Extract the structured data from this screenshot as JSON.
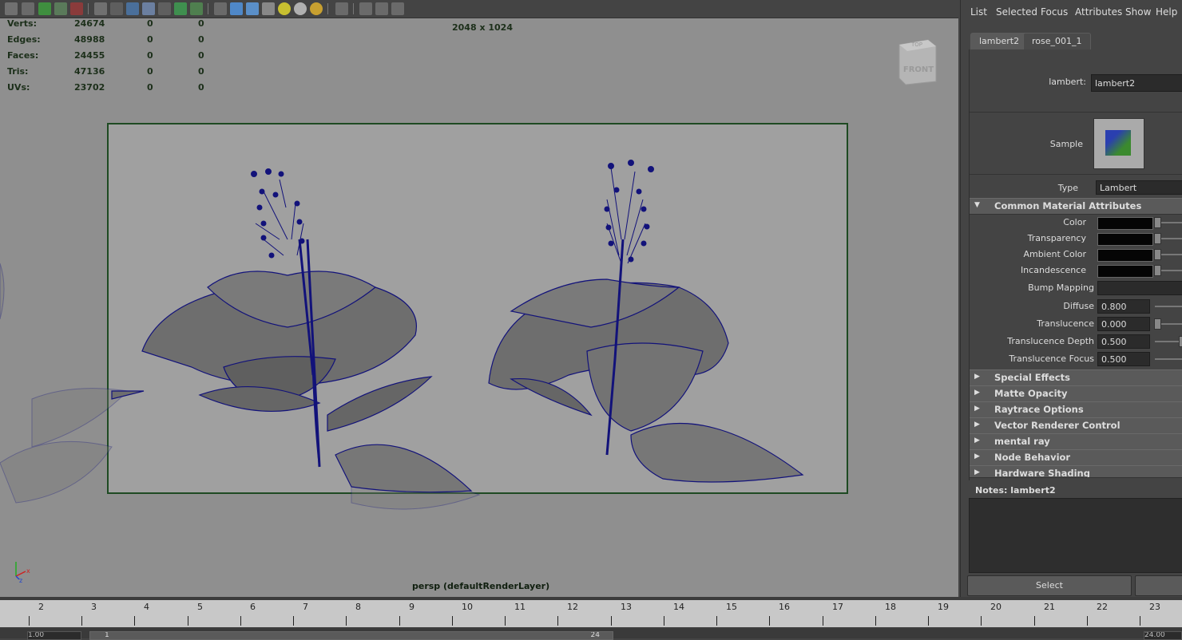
{
  "hud": {
    "rows": [
      {
        "label": "Verts:",
        "value": "24674",
        "c1": "0",
        "c2": "0"
      },
      {
        "label": "Edges:",
        "value": "48988",
        "c1": "0",
        "c2": "0"
      },
      {
        "label": "Faces:",
        "value": "24455",
        "c1": "0",
        "c2": "0"
      },
      {
        "label": "Tris:",
        "value": "47136",
        "c1": "0",
        "c2": "0"
      },
      {
        "label": "UVs:",
        "value": "23702",
        "c1": "0",
        "c2": "0"
      }
    ],
    "resolution": "2048 x 1024",
    "camera": "persp (defaultRenderLayer)"
  },
  "viewcube": {
    "top": "TOP",
    "front": "FRONT"
  },
  "toolbar_icons": [
    "camera-icon",
    "attributes-icon",
    "bookmark-icon",
    "image-plane-icon",
    "grid-icon",
    "film-gate-icon",
    "resolution-gate-icon",
    "safe-area-icon",
    "wireframe-icon",
    "smooth-shade-icon",
    "wireframe-on-shaded-icon",
    "xray-icon",
    "default-material-icon",
    "textured-icon",
    "lights-icon",
    "shadows-icon",
    "select-camera-icon",
    "isolate-icon",
    "frame-all-icon",
    "frame-selection-icon",
    "share-icon"
  ],
  "panel": {
    "menu": [
      "List",
      "Selected",
      "Focus",
      "Attributes",
      "Show",
      "Help"
    ],
    "tabs": [
      "lambert2",
      "rose_001_1"
    ],
    "node_label": "lambert:",
    "node_value": "lambert2",
    "sample_label": "Sample",
    "type_label": "Type",
    "type_value": "Lambert",
    "common_section": "Common Material Attributes",
    "color_attrs": [
      {
        "label": "Color"
      },
      {
        "label": "Transparency"
      },
      {
        "label": "Ambient Color"
      },
      {
        "label": "Incandescence"
      }
    ],
    "bump_label": "Bump Mapping",
    "numeric_attrs": [
      {
        "label": "Diffuse",
        "value": "0.800"
      },
      {
        "label": "Translucence",
        "value": "0.000"
      },
      {
        "label": "Translucence Depth",
        "value": "0.500"
      },
      {
        "label": "Translucence Focus",
        "value": "0.500"
      }
    ],
    "collapsed_sections": [
      "Special Effects",
      "Matte Opacity",
      "Raytrace Options",
      "Vector Renderer Control",
      "mental ray",
      "Node Behavior",
      "Hardware Shading"
    ],
    "notes_label": "Notes:",
    "notes_value": "lambert2",
    "buttons": [
      "Select",
      ""
    ]
  },
  "timeline": {
    "frames": [
      "2",
      "3",
      "4",
      "5",
      "6",
      "7",
      "8",
      "9",
      "10",
      "11",
      "12",
      "13",
      "14",
      "15",
      "16",
      "17",
      "18",
      "19",
      "20",
      "21",
      "22",
      "23"
    ],
    "range_start": "1.00",
    "range_inner_start": "1",
    "range_inner_end": "24",
    "range_end": "24.00"
  },
  "colors": {
    "wire": "#12127a",
    "gate": "#1e4a22",
    "viewport_bg": "#8f8f8f"
  }
}
